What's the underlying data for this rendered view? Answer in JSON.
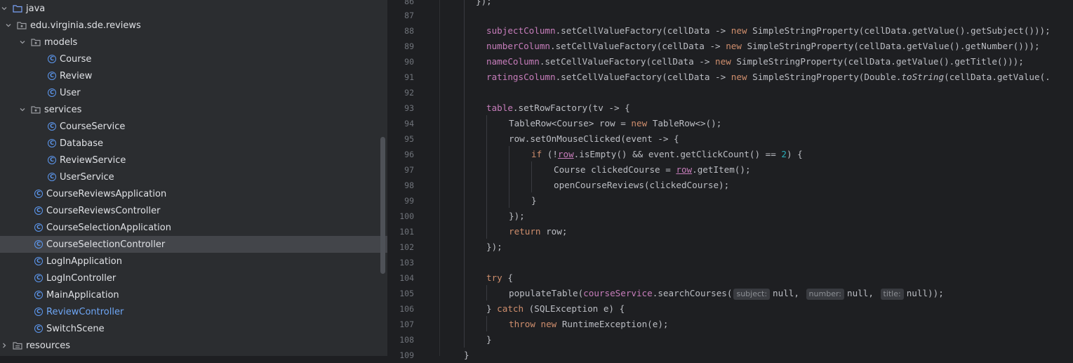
{
  "colors": {
    "tree_bg": "#2b2d30",
    "editor_bg": "#1e1f22",
    "selected_row": "#43454a",
    "modified_file": "#6ea6f5",
    "class_icon": "#5c97ee",
    "keyword": "#cf8e6d",
    "field": "#c77dbb",
    "number": "#2aacb8"
  },
  "tree": {
    "items": [
      {
        "label": "java",
        "type": "folder",
        "expanded": true
      },
      {
        "label": "edu.virginia.sde.reviews",
        "type": "package",
        "expanded": true
      },
      {
        "label": "models",
        "type": "package",
        "expanded": true
      },
      {
        "label": "Course",
        "type": "class"
      },
      {
        "label": "Review",
        "type": "class"
      },
      {
        "label": "User",
        "type": "class"
      },
      {
        "label": "services",
        "type": "package",
        "expanded": true
      },
      {
        "label": "CourseService",
        "type": "class"
      },
      {
        "label": "Database",
        "type": "class"
      },
      {
        "label": "ReviewService",
        "type": "class"
      },
      {
        "label": "UserService",
        "type": "class"
      },
      {
        "label": "CourseReviewsApplication",
        "type": "class"
      },
      {
        "label": "CourseReviewsController",
        "type": "class"
      },
      {
        "label": "CourseSelectionApplication",
        "type": "class"
      },
      {
        "label": "CourseSelectionController",
        "type": "class",
        "selected": true
      },
      {
        "label": "LogInApplication",
        "type": "class"
      },
      {
        "label": "LogInController",
        "type": "class"
      },
      {
        "label": "MainApplication",
        "type": "class"
      },
      {
        "label": "ReviewController",
        "type": "class",
        "modified": true
      },
      {
        "label": "SwitchScene",
        "type": "class"
      },
      {
        "label": "resources",
        "type": "folder",
        "expanded": false
      }
    ]
  },
  "editor": {
    "lines": [
      {
        "n": "86",
        "text": "    });"
      },
      {
        "n": "87",
        "text": ""
      },
      {
        "n": "88",
        "text": "subjectColumn.setCellValueFactory(cellData -> new SimpleStringProperty(cellData.getValue().getSubject()));"
      },
      {
        "n": "89",
        "text": "numberColumn.setCellValueFactory(cellData -> new SimpleStringProperty(cellData.getValue().getNumber()));"
      },
      {
        "n": "90",
        "text": "nameColumn.setCellValueFactory(cellData -> new SimpleStringProperty(cellData.getValue().getTitle()));"
      },
      {
        "n": "91",
        "text": "ratingsColumn.setCellValueFactory(cellData -> new SimpleStringProperty(Double.toString(cellData.getValue(."
      },
      {
        "n": "92",
        "text": ""
      },
      {
        "n": "93",
        "text": "table.setRowFactory(tv -> {"
      },
      {
        "n": "94",
        "text": "TableRow<Course> row = new TableRow<>();"
      },
      {
        "n": "95",
        "text": "row.setOnMouseClicked(event -> {"
      },
      {
        "n": "96",
        "text": "if (!row.isEmpty() && event.getClickCount() == 2) {"
      },
      {
        "n": "97",
        "text": "Course clickedCourse = row.getItem();"
      },
      {
        "n": "98",
        "text": "openCourseReviews(clickedCourse);"
      },
      {
        "n": "99",
        "text": "}"
      },
      {
        "n": "100",
        "text": "});"
      },
      {
        "n": "101",
        "text": "return row;"
      },
      {
        "n": "102",
        "text": "});"
      },
      {
        "n": "103",
        "text": ""
      },
      {
        "n": "104",
        "text": "try {"
      },
      {
        "n": "105",
        "text": "populateTable(courseService.searchCourses( subject: null,  number: null,  title: null));"
      },
      {
        "n": "106",
        "text": "} catch (SQLException e) {"
      },
      {
        "n": "107",
        "text": "throw new RuntimeException(e);"
      },
      {
        "n": "108",
        "text": "}"
      },
      {
        "n": "109",
        "text": "}"
      }
    ],
    "hints": {
      "subject": "subject:",
      "number": "number:",
      "title": "title:"
    }
  }
}
